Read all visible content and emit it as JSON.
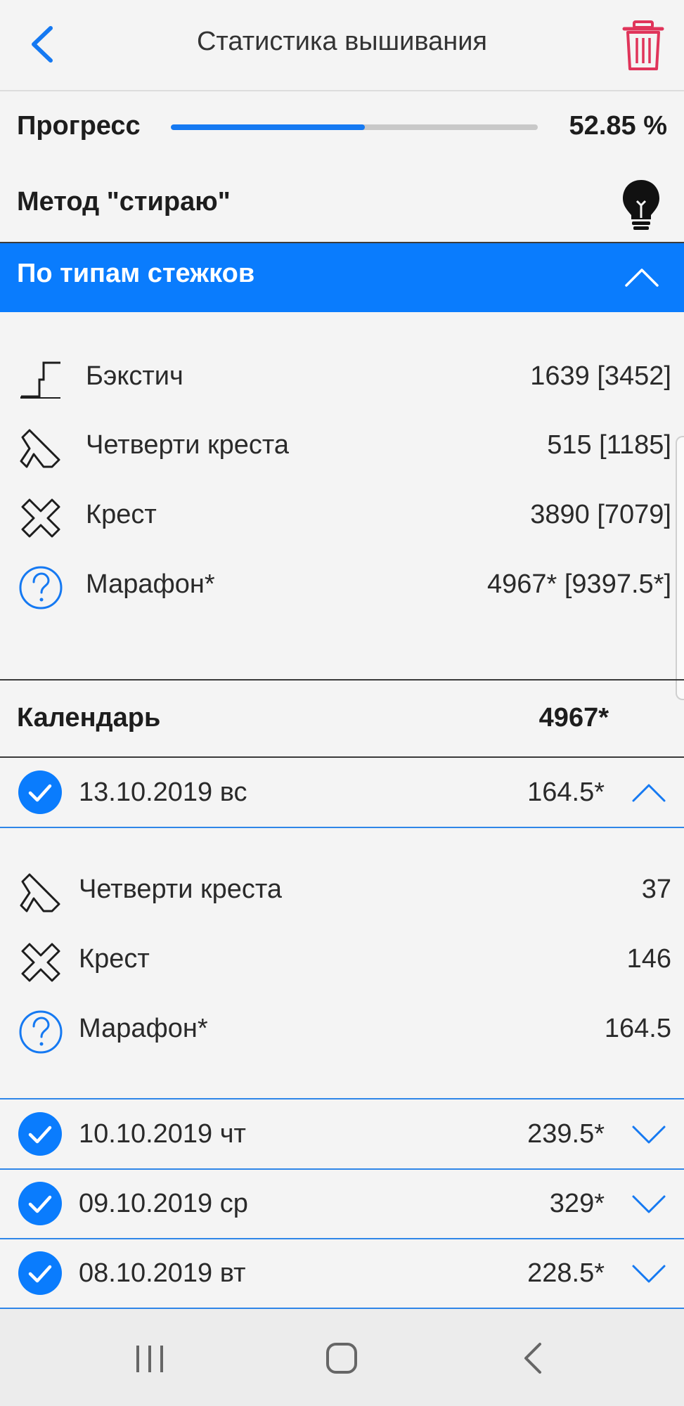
{
  "header": {
    "title": "Статистика вышивания",
    "back_icon": "chevron-left-icon",
    "delete_icon": "trash-icon"
  },
  "progress": {
    "label": "Прогресс",
    "value_text": "52.85 %",
    "fraction": 0.5285
  },
  "method": {
    "label": "Метод \"стираю\"",
    "icon": "lightbulb-icon"
  },
  "stitch_types": {
    "header": "По типам стежков",
    "items": [
      {
        "icon": "backstitch-icon",
        "label": "Бэкстич",
        "value": "1639 [3452]"
      },
      {
        "icon": "quarter-cross-icon",
        "label": "Четверти креста",
        "value": "515 [1185]"
      },
      {
        "icon": "cross-icon",
        "label": "Крест",
        "value": "3890 [7079]"
      },
      {
        "icon": "question-icon",
        "label": "Марафон*",
        "value": "4967* [9397.5*]"
      }
    ]
  },
  "calendar": {
    "label": "Календарь",
    "total": "4967*",
    "days": [
      {
        "date": "13.10.2019 вс",
        "value": "164.5*",
        "expanded": true,
        "items": [
          {
            "icon": "quarter-cross-icon",
            "label": "Четверти креста",
            "value": "37"
          },
          {
            "icon": "cross-icon",
            "label": "Крест",
            "value": "146"
          },
          {
            "icon": "question-icon",
            "label": "Марафон*",
            "value": "164.5"
          }
        ]
      },
      {
        "date": "10.10.2019 чт",
        "value": "239.5*",
        "expanded": false
      },
      {
        "date": "09.10.2019 ср",
        "value": "329*",
        "expanded": false
      },
      {
        "date": "08.10.2019 вт",
        "value": "228.5*",
        "expanded": false
      }
    ]
  },
  "colors": {
    "accent": "#0a7cfd",
    "delete": "#e0345a",
    "background": "#f4f4f4"
  },
  "navigation": {
    "recents_icon": "recents-icon",
    "home_icon": "home-icon",
    "back_icon": "back-icon"
  }
}
